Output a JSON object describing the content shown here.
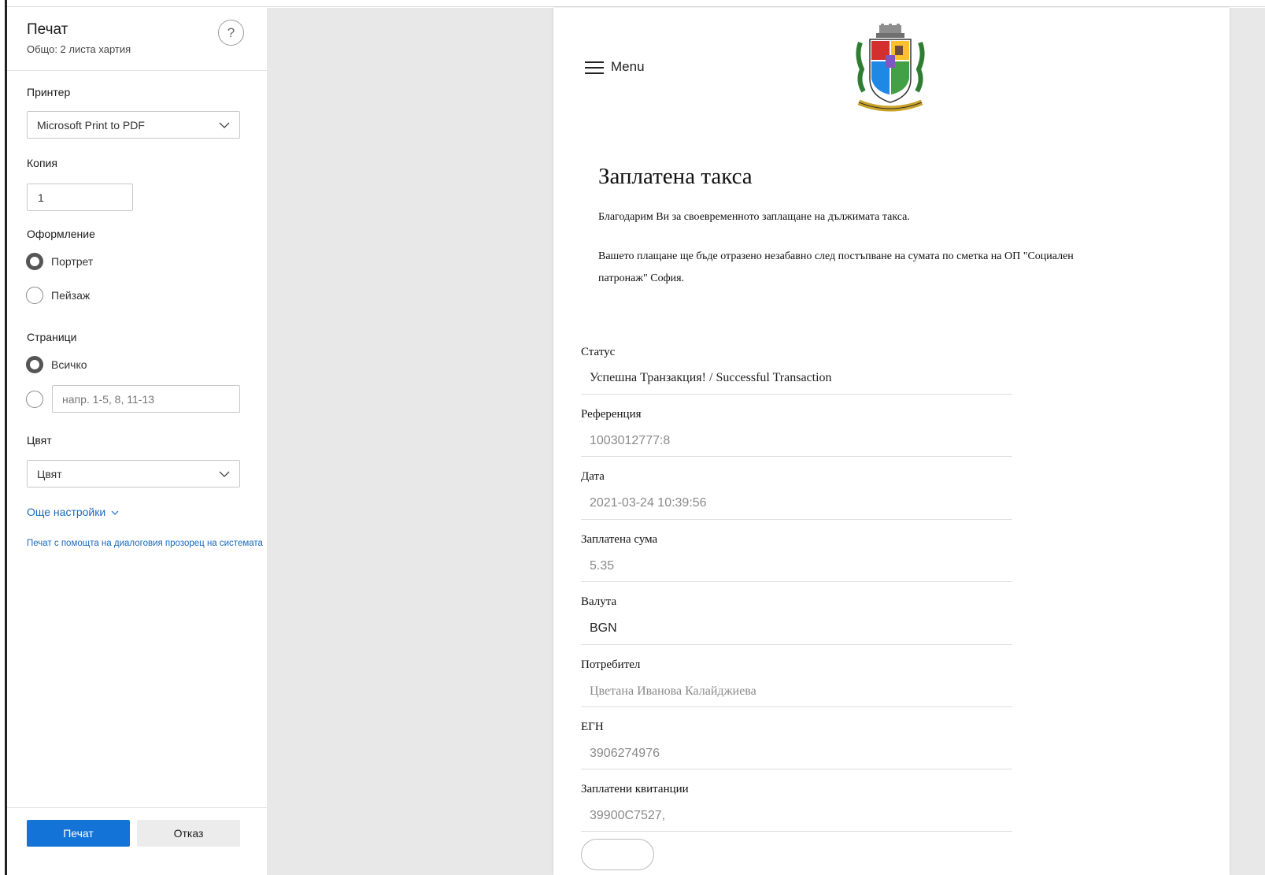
{
  "print_panel": {
    "title": "Печат",
    "subtitle": "Общо: 2 листа хартия",
    "help_label": "?",
    "printer_label": "Принтер",
    "printer_value": "Microsoft Print to PDF",
    "copies_label": "Копия",
    "copies_value": "1",
    "layout_label": "Оформление",
    "layout_options": [
      {
        "label": "Портрет",
        "checked": true
      },
      {
        "label": "Пейзаж",
        "checked": false
      }
    ],
    "pages_label": "Страници",
    "pages_all_label": "Всичко",
    "pages_all_checked": true,
    "pages_custom_placeholder": "напр. 1-5, 8, 11-13",
    "color_label": "Цвят",
    "color_value": "Цвят",
    "more_settings_label": "Още настройки",
    "system_dialog_link": "Печат с помощта на диалоговия прозорец на системата",
    "print_button": "Печат",
    "cancel_button": "Отказ"
  },
  "preview": {
    "menu_label": "Menu",
    "title": "Заплатена такса",
    "paragraph_1": "Благодарим Ви за своевременното заплащане на дължимата такса.",
    "paragraph_2_line_1": "Вашето плащане ще бъде отразено незабавно след постъпване на сумата по сметка на ОП \"Социален",
    "paragraph_2_line_2": "патронаж\" София.",
    "fields": [
      {
        "label": "Статус",
        "value": "Успешна Транзакция! / Successful Transaction"
      },
      {
        "label": "Референция",
        "value": "1003012777:8"
      },
      {
        "label": "Дата",
        "value": "2021-03-24 10:39:56"
      },
      {
        "label": "Заплатена сума",
        "value": "5.35"
      },
      {
        "label": "Валута",
        "value": "BGN"
      },
      {
        "label": "Потребител",
        "value": "Цветана Иванова Калайджиева"
      },
      {
        "label": "ЕГН",
        "value": "3906274976"
      },
      {
        "label": "Заплатени квитанции",
        "value": "39900C7527,"
      }
    ]
  },
  "colors": {
    "accent_blue": "#1373d6",
    "link_blue": "#1a6bbf",
    "preview_background": "#e8e8e8"
  },
  "icons": [
    "help-icon",
    "chevron-down-icon",
    "radio-icon",
    "hamburger-menu-icon",
    "sofia-coat-of-arms-icon"
  ]
}
